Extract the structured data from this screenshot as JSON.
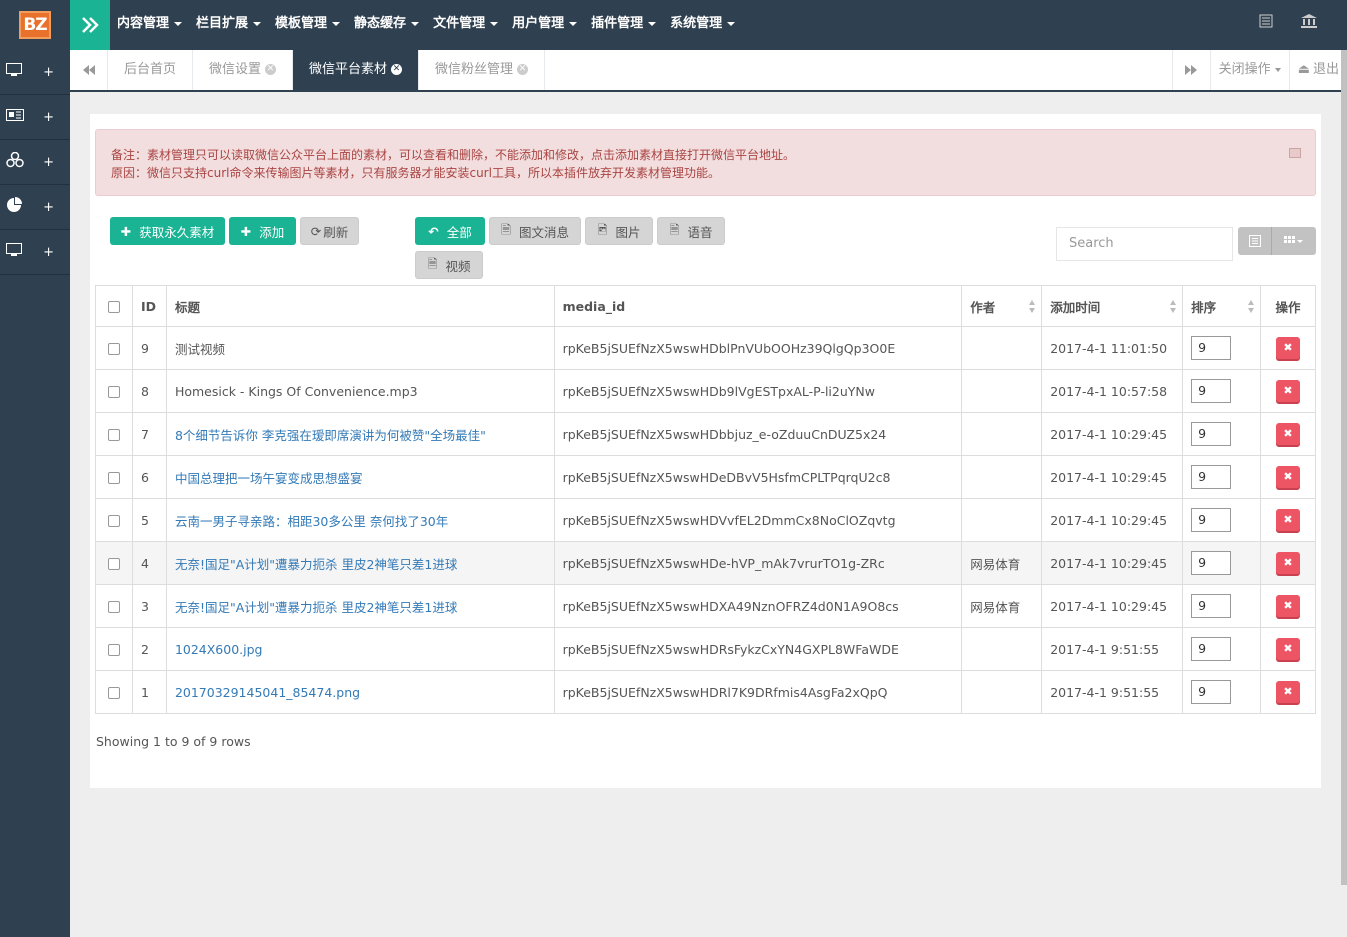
{
  "app": {
    "logo_text": "BZ"
  },
  "topnav": [
    {
      "label": "内容管理"
    },
    {
      "label": "栏目扩展"
    },
    {
      "label": "模板管理"
    },
    {
      "label": "静态缓存"
    },
    {
      "label": "文件管理"
    },
    {
      "label": "用户管理"
    },
    {
      "label": "插件管理"
    },
    {
      "label": "系统管理"
    }
  ],
  "sidebar": {
    "items": [
      {
        "icon": "desktop-icon",
        "plus": "+"
      },
      {
        "icon": "newspaper-icon",
        "plus": "+"
      },
      {
        "icon": "cubes-icon",
        "plus": "+"
      },
      {
        "icon": "pie-chart-icon",
        "plus": "+"
      },
      {
        "icon": "monitor-icon",
        "plus": "+"
      }
    ]
  },
  "tabs": [
    {
      "label": "后台首页",
      "active": false,
      "closable": false
    },
    {
      "label": "微信设置",
      "active": false,
      "closable": true
    },
    {
      "label": "微信平台素材",
      "active": true,
      "closable": true
    },
    {
      "label": "微信粉丝管理",
      "active": false,
      "closable": true
    }
  ],
  "tabs_right": {
    "close_ops": "关闭操作",
    "logout": "退出"
  },
  "alert": {
    "line1": "备注：素材管理只可以读取微信公众平台上面的素材，可以查看和删除，不能添加和修改，点击添加素材直接打开微信平台地址。",
    "line2": "原因：微信只支持curl命令来传输图片等素材，只有服务器才能安装curl工具，所以本插件放弃开发素材管理功能。"
  },
  "toolbar": {
    "fetch": "获取永久素材",
    "add": "添加",
    "refresh": "刷新",
    "all": "全部",
    "news": "图文消息",
    "image": "图片",
    "voice": "语音",
    "video": "视频"
  },
  "search": {
    "placeholder": "Search"
  },
  "table": {
    "headers": {
      "id": "ID",
      "title": "标题",
      "media_id": "media_id",
      "author": "作者",
      "time": "添加时间",
      "order": "排序",
      "action": "操作"
    },
    "rows": [
      {
        "id": "9",
        "title": "测试视频",
        "link": false,
        "media_id": "rpKeB5jSUEfNzX5wswHDblPnVUbOOHz39QlgQp3O0E",
        "author": "",
        "time": "2017-4-1 11:01:50",
        "order": "9",
        "highlight": false
      },
      {
        "id": "8",
        "title": "Homesick - Kings Of Convenience.mp3",
        "link": false,
        "media_id": "rpKeB5jSUEfNzX5wswHDb9lVgESTpxAL-P-li2uYNw",
        "author": "",
        "time": "2017-4-1 10:57:58",
        "order": "9",
        "highlight": false
      },
      {
        "id": "7",
        "title": "8个细节告诉你 李克强在瑷即席演讲为何被赞\"全场最佳\"",
        "link": true,
        "media_id": "rpKeB5jSUEfNzX5wswHDbbjuz_e-oZduuCnDUZ5x24",
        "author": "",
        "time": "2017-4-1 10:29:45",
        "order": "9",
        "highlight": false
      },
      {
        "id": "6",
        "title": "中国总理把一场午宴变成思想盛宴",
        "link": true,
        "media_id": "rpKeB5jSUEfNzX5wswHDeDBvV5HsfmCPLTPqrqU2c8",
        "author": "",
        "time": "2017-4-1 10:29:45",
        "order": "9",
        "highlight": false
      },
      {
        "id": "5",
        "title": "云南一男子寻亲路：相距30多公里 奈何找了30年",
        "link": true,
        "media_id": "rpKeB5jSUEfNzX5wswHDVvfEL2DmmCx8NoClOZqvtg",
        "author": "",
        "time": "2017-4-1 10:29:45",
        "order": "9",
        "highlight": false
      },
      {
        "id": "4",
        "title": "无奈!国足\"A计划\"遭暴力扼杀 里皮2神笔只差1进球",
        "link": true,
        "media_id": "rpKeB5jSUEfNzX5wswHDe-hVP_mAk7vrurTO1g-ZRc",
        "author": "网易体育",
        "time": "2017-4-1 10:29:45",
        "order": "9",
        "highlight": true
      },
      {
        "id": "3",
        "title": "无奈!国足\"A计划\"遭暴力扼杀 里皮2神笔只差1进球",
        "link": true,
        "media_id": "rpKeB5jSUEfNzX5wswHDXA49NznOFRZ4d0N1A9O8cs",
        "author": "网易体育",
        "time": "2017-4-1 10:29:45",
        "order": "9",
        "highlight": false
      },
      {
        "id": "2",
        "title": "1024X600.jpg",
        "link": true,
        "media_id": "rpKeB5jSUEfNzX5wswHDRsFykzCxYN4GXPL8WFaWDE",
        "author": "",
        "time": "2017-4-1 9:51:55",
        "order": "9",
        "highlight": false
      },
      {
        "id": "1",
        "title": "20170329145041_85474.png",
        "link": true,
        "media_id": "rpKeB5jSUEfNzX5wswHDRl7K9DRfmis4AsgFa2xQpQ",
        "author": "",
        "time": "2017-4-1 9:51:55",
        "order": "9",
        "highlight": false
      }
    ]
  },
  "pagination": {
    "info": "Showing 1 to 9 of 9 rows"
  },
  "colors": {
    "sidebar_bg": "#2f4050",
    "accent": "#1ab394",
    "danger": "#ed5565",
    "link": "#337ab7"
  }
}
